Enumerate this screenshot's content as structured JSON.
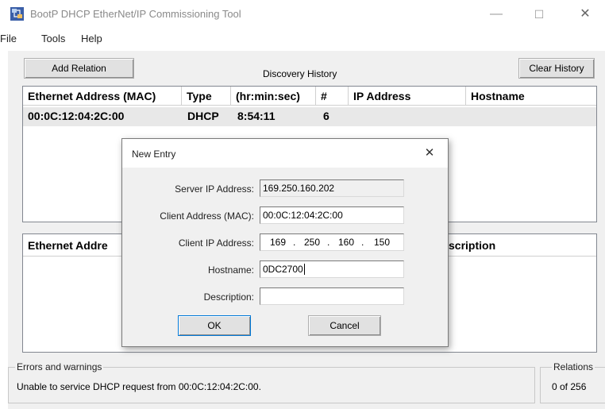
{
  "window": {
    "title": "BootP DHCP EtherNet/IP Commissioning Tool",
    "icon": "network-app-icon",
    "minimize_glyph": "—",
    "maximize_glyph": "☐",
    "close_glyph": "✕"
  },
  "menu": {
    "items": [
      "File",
      "Tools",
      "Help"
    ]
  },
  "toolbar": {
    "add_relation": "Add Relation",
    "history_title": "Discovery History",
    "clear_history": "Clear History"
  },
  "history": {
    "columns": [
      "Ethernet Address (MAC)",
      "Type",
      "(hr:min:sec)",
      "#",
      "IP Address",
      "Hostname"
    ],
    "rows": [
      {
        "mac": "00:0C:12:04:2C:00",
        "type": "DHCP",
        "time": "8:54:11",
        "count": "6",
        "ip": "",
        "hostname": ""
      }
    ]
  },
  "relations": {
    "columns_visible": [
      "Ethernet Addre",
      "scription"
    ]
  },
  "dialog": {
    "title": "New Entry",
    "close_glyph": "✕",
    "server_ip_label": "Server IP Address:",
    "server_ip_value": "169.250.160.202",
    "client_mac_label": "Client Address (MAC):",
    "client_mac_value": "00:0C:12:04:2C:00",
    "client_ip_label": "Client IP Address:",
    "client_ip_octets": [
      "169",
      "250",
      "160",
      "150"
    ],
    "hostname_label": "Hostname:",
    "hostname_value": "0DC2700",
    "description_label": "Description:",
    "description_value": "",
    "ok": "OK",
    "cancel": "Cancel"
  },
  "status": {
    "errors_title": "Errors and warnings",
    "message": "Unable to service DHCP request from 00:0C:12:04:2C:00.",
    "relations_title": "Relations",
    "relations_count": "0 of 256"
  }
}
